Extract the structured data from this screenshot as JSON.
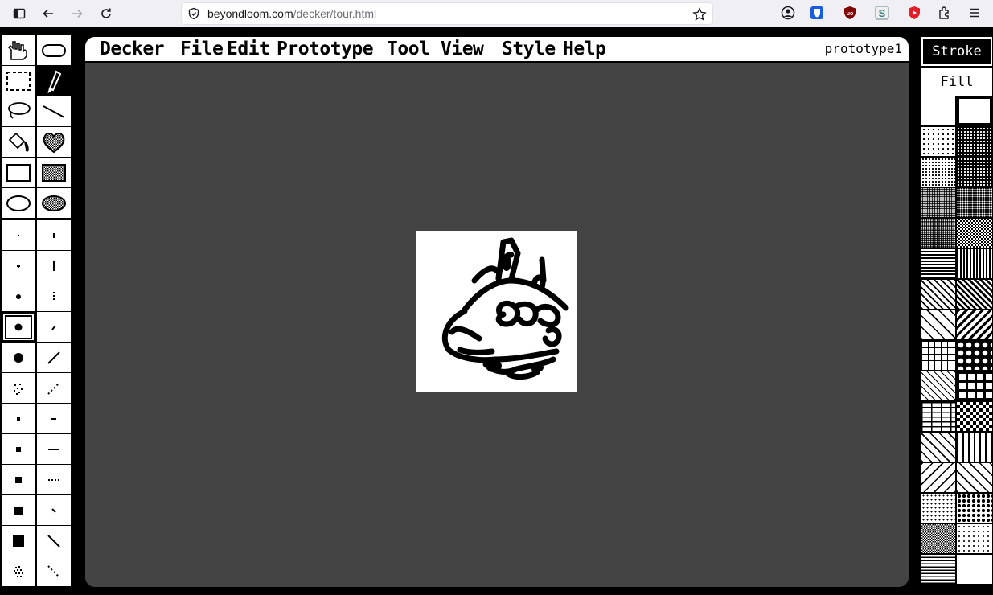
{
  "browser": {
    "url_domain": "beyondloom.com",
    "url_path": "/decker/tour.html",
    "buttons": [
      "sidebar-icon",
      "back-icon",
      "forward-icon",
      "reload-icon"
    ],
    "extensions": [
      "account-icon",
      "bitwarden-icon",
      "ublock-icon",
      "s-extension-icon",
      "video-extension-icon",
      "extensions-icon",
      "menu-icon"
    ]
  },
  "decker": {
    "menu": [
      "Decker",
      "File",
      "Edit",
      "Prototype",
      "Tool",
      "View",
      "Style",
      "Help"
    ],
    "deck_name": "prototype1",
    "stroke_label": "Stroke",
    "fill_label": "Fill"
  },
  "colors": {
    "canvas_bg": "#444444",
    "ui_black": "#000000",
    "ui_white": "#ffffff"
  }
}
